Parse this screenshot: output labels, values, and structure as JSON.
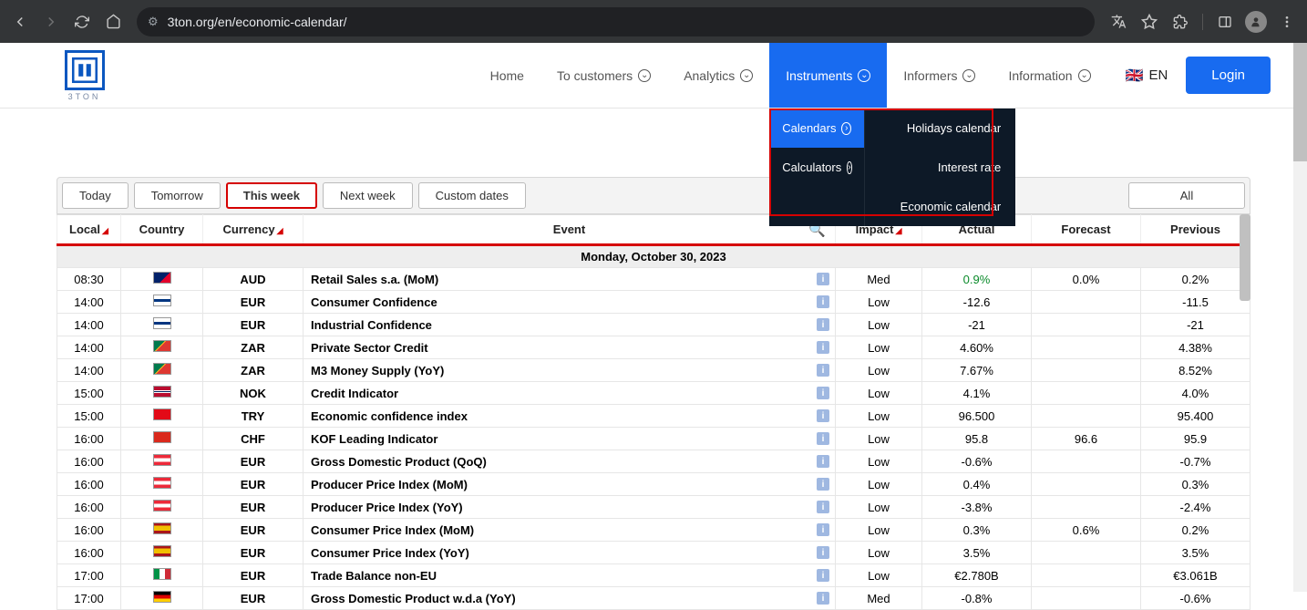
{
  "browser": {
    "url": "3ton.org/en/economic-calendar/"
  },
  "nav": {
    "home": "Home",
    "to_customers": "To customers",
    "analytics": "Analytics",
    "instruments": "Instruments",
    "informers": "Informers",
    "information": "Information",
    "lang": "EN",
    "login": "Login"
  },
  "dropdown": {
    "left": {
      "calendars": "Calendars",
      "calculators": "Calculators"
    },
    "right": {
      "holidays": "Holidays calendar",
      "interest": "Interest rate",
      "economic": "Economic calendar"
    }
  },
  "filters": {
    "today": "Today",
    "tomorrow": "Tomorrow",
    "this_week": "This week",
    "next_week": "Next week",
    "custom": "Custom dates",
    "all": "All"
  },
  "headers": {
    "local": "Local",
    "country": "Country",
    "currency": "Currency",
    "event": "Event",
    "impact": "Impact",
    "actual": "Actual",
    "forecast": "Forecast",
    "previous": "Previous"
  },
  "date_header": "Monday, October 30, 2023",
  "rows": [
    {
      "time": "08:30",
      "flag": "au",
      "currency": "AUD",
      "event": "Retail Sales s.a. (MoM)",
      "impact": "Med",
      "actual": "0.9%",
      "actual_pos": true,
      "forecast": "0.0%",
      "previous": "0.2%"
    },
    {
      "time": "14:00",
      "flag": "fi",
      "currency": "EUR",
      "event": "Consumer Confidence",
      "impact": "Low",
      "actual": "-12.6",
      "forecast": "",
      "previous": "-11.5"
    },
    {
      "time": "14:00",
      "flag": "fi",
      "currency": "EUR",
      "event": "Industrial Confidence",
      "impact": "Low",
      "actual": "-21",
      "forecast": "",
      "previous": "-21"
    },
    {
      "time": "14:00",
      "flag": "za",
      "currency": "ZAR",
      "event": "Private Sector Credit",
      "impact": "Low",
      "actual": "4.60%",
      "forecast": "",
      "previous": "4.38%"
    },
    {
      "time": "14:00",
      "flag": "za",
      "currency": "ZAR",
      "event": "M3 Money Supply (YoY)",
      "impact": "Low",
      "actual": "7.67%",
      "forecast": "",
      "previous": "8.52%"
    },
    {
      "time": "15:00",
      "flag": "no",
      "currency": "NOK",
      "event": "Credit Indicator",
      "impact": "Low",
      "actual": "4.1%",
      "forecast": "",
      "previous": "4.0%"
    },
    {
      "time": "15:00",
      "flag": "tr",
      "currency": "TRY",
      "event": "Economic confidence index",
      "impact": "Low",
      "actual": "96.500",
      "forecast": "",
      "previous": "95.400"
    },
    {
      "time": "16:00",
      "flag": "ch",
      "currency": "CHF",
      "event": "KOF Leading Indicator",
      "impact": "Low",
      "actual": "95.8",
      "forecast": "96.6",
      "previous": "95.9"
    },
    {
      "time": "16:00",
      "flag": "at",
      "currency": "EUR",
      "event": "Gross Domestic Product (QoQ)",
      "impact": "Low",
      "actual": "-0.6%",
      "forecast": "",
      "previous": "-0.7%"
    },
    {
      "time": "16:00",
      "flag": "at",
      "currency": "EUR",
      "event": "Producer Price Index (MoM)",
      "impact": "Low",
      "actual": "0.4%",
      "forecast": "",
      "previous": "0.3%"
    },
    {
      "time": "16:00",
      "flag": "at",
      "currency": "EUR",
      "event": "Producer Price Index (YoY)",
      "impact": "Low",
      "actual": "-3.8%",
      "forecast": "",
      "previous": "-2.4%"
    },
    {
      "time": "16:00",
      "flag": "es",
      "currency": "EUR",
      "event": "Consumer Price Index (MoM)",
      "impact": "Low",
      "actual": "0.3%",
      "forecast": "0.6%",
      "previous": "0.2%"
    },
    {
      "time": "16:00",
      "flag": "es",
      "currency": "EUR",
      "event": "Consumer Price Index (YoY)",
      "impact": "Low",
      "actual": "3.5%",
      "forecast": "",
      "previous": "3.5%"
    },
    {
      "time": "17:00",
      "flag": "it",
      "currency": "EUR",
      "event": "Trade Balance non-EU",
      "impact": "Low",
      "actual": "€2.780B",
      "forecast": "",
      "previous": "€3.061B"
    },
    {
      "time": "17:00",
      "flag": "de",
      "currency": "EUR",
      "event": "Gross Domestic Product w.d.a (YoY)",
      "impact": "Med",
      "actual": "-0.8%",
      "forecast": "",
      "previous": "-0.6%"
    }
  ]
}
